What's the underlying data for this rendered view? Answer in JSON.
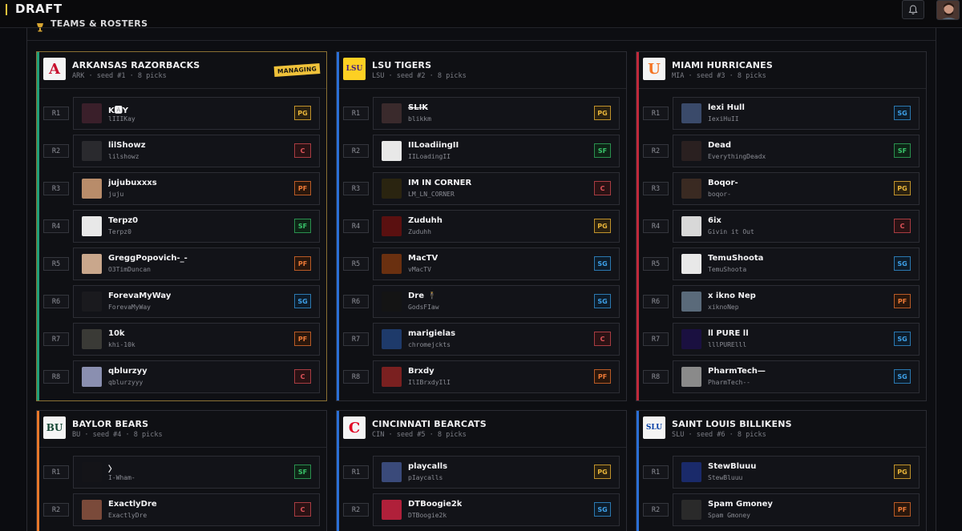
{
  "app": {
    "title": "DRAFT"
  },
  "panel": {
    "title": "TEAMS & ROSTERS"
  },
  "colors": {
    "accent": "#f5c33b",
    "managing_badge": "#f0c23a"
  },
  "teams": [
    {
      "name": "ARKANSAS RAZORBACKS",
      "meta": "ARK · seed #1 · 8 picks",
      "stripe": "#1fa07a",
      "managing": true,
      "badge": "MANAGING",
      "logo_text": "A",
      "logo_color": "#c8102e",
      "logo_bg": "#f4f4f4",
      "picks": [
        {
          "round": "R1",
          "name": "K🅰Y",
          "user": "lIIIKay",
          "pos": "PG",
          "avatar": "#3a1f2a"
        },
        {
          "round": "R2",
          "name": "lilShowz",
          "user": "lilshowz",
          "pos": "C",
          "avatar": "#2a2a2e"
        },
        {
          "round": "R3",
          "name": "jujubuxxxs",
          "user": "juju",
          "pos": "PF",
          "avatar": "#b88c6a"
        },
        {
          "round": "R4",
          "name": "Terpz0",
          "user": "Terpz0",
          "pos": "SF",
          "avatar": "#e8e8e8"
        },
        {
          "round": "R5",
          "name": "GreggPopovich-_-",
          "user": "O3TimDuncan",
          "pos": "PF",
          "avatar": "#c9a78c"
        },
        {
          "round": "R6",
          "name": "ForevaMyWay",
          "user": "ForevaMyWay",
          "pos": "SG",
          "avatar": "#1a1a1e"
        },
        {
          "round": "R7",
          "name": "10k",
          "user": "khi-10k",
          "pos": "PF",
          "avatar": "#3a3a36"
        },
        {
          "round": "R8",
          "name": "qblurzyy",
          "user": "qblurzyyy",
          "pos": "C",
          "avatar": "#8a8fb0"
        }
      ]
    },
    {
      "name": "LSU TIGERS",
      "meta": "LSU · seed #2 · 8 picks",
      "stripe": "#2a6fd6",
      "managing": false,
      "badge": "",
      "logo_text": "LSU",
      "logo_color": "#461d7c",
      "logo_bg": "#fdd023",
      "picks": [
        {
          "round": "R1",
          "name": "S̶L̶I̶K̶",
          "user": "blikkm",
          "pos": "PG",
          "avatar": "#3a2a2c"
        },
        {
          "round": "R2",
          "name": "IILoadiingII",
          "user": "IILoadingII",
          "pos": "SF",
          "avatar": "#e8e8e8"
        },
        {
          "round": "R3",
          "name": "IM IN CORNER",
          "user": "LM_LN_CORNER",
          "pos": "C",
          "avatar": "#2a2410"
        },
        {
          "round": "R4",
          "name": "Zuduhh",
          "user": "Zuduhh",
          "pos": "PG",
          "avatar": "#5a1010"
        },
        {
          "round": "R5",
          "name": "MacTV",
          "user": "vMacTV",
          "pos": "SG",
          "avatar": "#6a3010"
        },
        {
          "round": "R6",
          "name": "Dre 🕴",
          "user": "GodsFIaw",
          "pos": "SG",
          "avatar": "#141414"
        },
        {
          "round": "R7",
          "name": "marigielas",
          "user": "chromejckts",
          "pos": "C",
          "avatar": "#1e3a6a"
        },
        {
          "round": "R8",
          "name": "Brxdy",
          "user": "IlIBrxdyIlI",
          "pos": "PF",
          "avatar": "#7a2020"
        }
      ]
    },
    {
      "name": "MIAMI HURRICANES",
      "meta": "MIA · seed #3 · 8 picks",
      "stripe": "#c0283a",
      "managing": false,
      "badge": "",
      "logo_text": "U",
      "logo_color": "#f47321",
      "logo_bg": "#f4f4f4",
      "picks": [
        {
          "round": "R1",
          "name": "lexi Hull",
          "user": "IexiHuII",
          "pos": "SG",
          "avatar": "#3a4a6a"
        },
        {
          "round": "R2",
          "name": "Dead",
          "user": "EverythingDeadx",
          "pos": "SF",
          "avatar": "#2a2020"
        },
        {
          "round": "R3",
          "name": "Boqor-",
          "user": "boqor-",
          "pos": "PG",
          "avatar": "#3a2a22"
        },
        {
          "round": "R4",
          "name": "6ix",
          "user": "Givin it Out",
          "pos": "C",
          "avatar": "#d8d8d8"
        },
        {
          "round": "R5",
          "name": "TemuShoota",
          "user": "TemuShoota",
          "pos": "SG",
          "avatar": "#e8e8e8"
        },
        {
          "round": "R6",
          "name": "x ikno Nep",
          "user": "xiknoNep",
          "pos": "PF",
          "avatar": "#5a6a7a"
        },
        {
          "round": "R7",
          "name": "ll PURE ll",
          "user": "lllPURElll",
          "pos": "SG",
          "avatar": "#1a1040"
        },
        {
          "round": "R8",
          "name": "PharmTech—",
          "user": "PharmTech--",
          "pos": "SG",
          "avatar": "#8a8a8a"
        }
      ]
    },
    {
      "name": "BAYLOR BEARS",
      "meta": "BU · seed #4 · 8 picks",
      "stripe": "#e8782a",
      "managing": false,
      "badge": "",
      "logo_text": "BU",
      "logo_color": "#154734",
      "logo_bg": "#f4f4f4",
      "picks": [
        {
          "round": "R1",
          "name": "〉",
          "user": "I-Wham-",
          "pos": "SF",
          "avatar": "#141418"
        },
        {
          "round": "R2",
          "name": "ExactlyDre",
          "user": "ExactlyDre",
          "pos": "C",
          "avatar": "#7a4a3a"
        }
      ]
    },
    {
      "name": "CINCINNATI BEARCATS",
      "meta": "CIN · seed #5 · 8 picks",
      "stripe": "#2a6fd6",
      "managing": false,
      "badge": "",
      "logo_text": "C",
      "logo_color": "#e00122",
      "logo_bg": "#f4f4f4",
      "picks": [
        {
          "round": "R1",
          "name": "playcalls",
          "user": "pIaycalls",
          "pos": "PG",
          "avatar": "#3a4a7a"
        },
        {
          "round": "R2",
          "name": "DTBoogie2k",
          "user": "DTBoogie2k",
          "pos": "SG",
          "avatar": "#b0203a"
        }
      ]
    },
    {
      "name": "SAINT LOUIS BILLIKENS",
      "meta": "SLU · seed #6 · 8 picks",
      "stripe": "#2a6fd6",
      "managing": false,
      "badge": "",
      "logo_text": "SLU",
      "logo_color": "#003da5",
      "logo_bg": "#f4f4f4",
      "picks": [
        {
          "round": "R1",
          "name": "StewBluuu",
          "user": "StewBluuu",
          "pos": "PG",
          "avatar": "#1a2a6a"
        },
        {
          "round": "R2",
          "name": "Spam Gmoney",
          "user": "Spam Gmoney",
          "pos": "PF",
          "avatar": "#2a2a2a"
        }
      ]
    }
  ]
}
